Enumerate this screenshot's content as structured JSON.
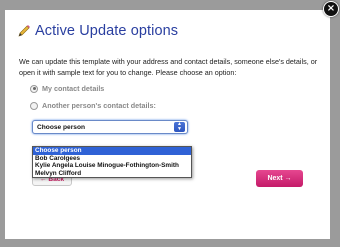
{
  "dialog": {
    "title": "Active Update options",
    "intro": "We can update this template with your address and contact details, someone else's details, or open it with sample text for you to change. Please choose an option:",
    "close_glyph": "×"
  },
  "options": {
    "my_contact": "My contact details",
    "another_contact": "Another person's contact details:"
  },
  "select": {
    "value": "Choose person",
    "arrow_glyph": "▲▼"
  },
  "dropdown_options": [
    "Choose person",
    "Bob Carolgees",
    "Kylie Angela Louise Minogue-Fothington-Smith",
    "Melvyn Clifford"
  ],
  "buttons": {
    "back": "← Back",
    "next": "Next →"
  },
  "colors": {
    "title": "#2a3fa0",
    "accent": "#c41a68",
    "selection": "#2f62d6"
  }
}
